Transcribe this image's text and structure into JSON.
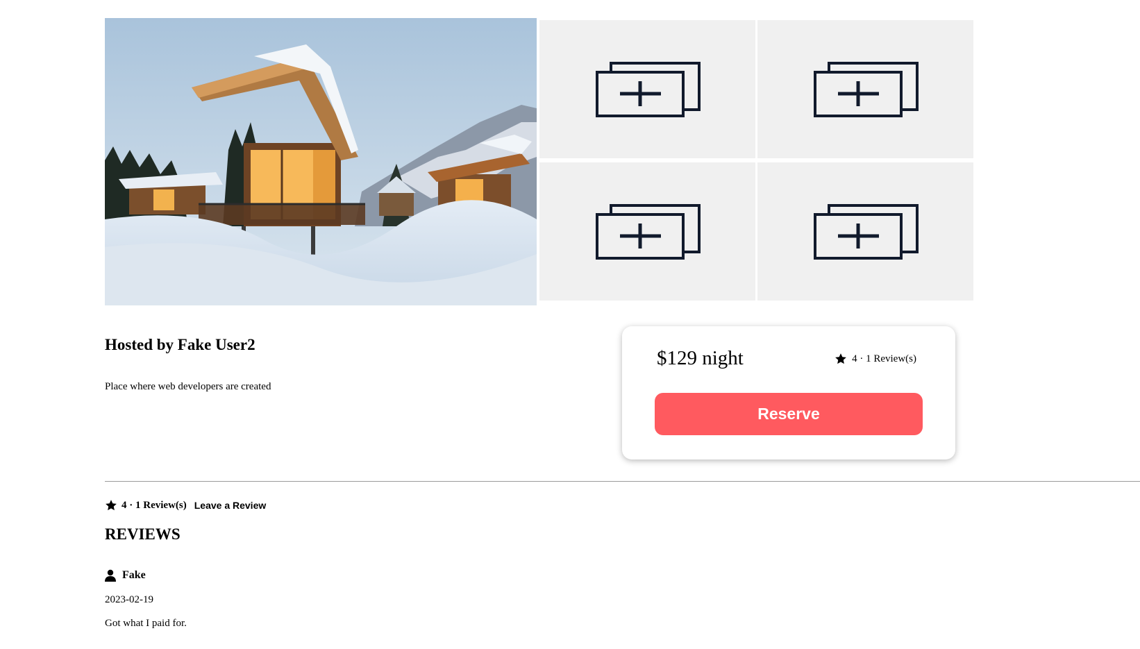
{
  "gallery": {
    "main_photo_alt": "",
    "placeholder_count": 4
  },
  "host": {
    "title": "Hosted by Fake User2",
    "description": "Place where web developers are created"
  },
  "booking": {
    "price": "$129 night",
    "rating": "4 · 1 Review(s)",
    "reserve_label": "Reserve"
  },
  "reviews_section": {
    "rating": "4 · 1 Review(s)",
    "leave_review_label": "Leave a Review",
    "heading": "REVIEWS",
    "items": [
      {
        "user": "Fake",
        "date": "2023-02-19",
        "text": "Got what I paid for."
      }
    ]
  },
  "icons": {
    "star": "star-icon",
    "user": "user-icon",
    "placeholder": "add-image-icon"
  },
  "colors": {
    "accent": "#ff5a5f",
    "placeholder_bg": "#f0f0f0",
    "icon_stroke": "#111a2c"
  }
}
